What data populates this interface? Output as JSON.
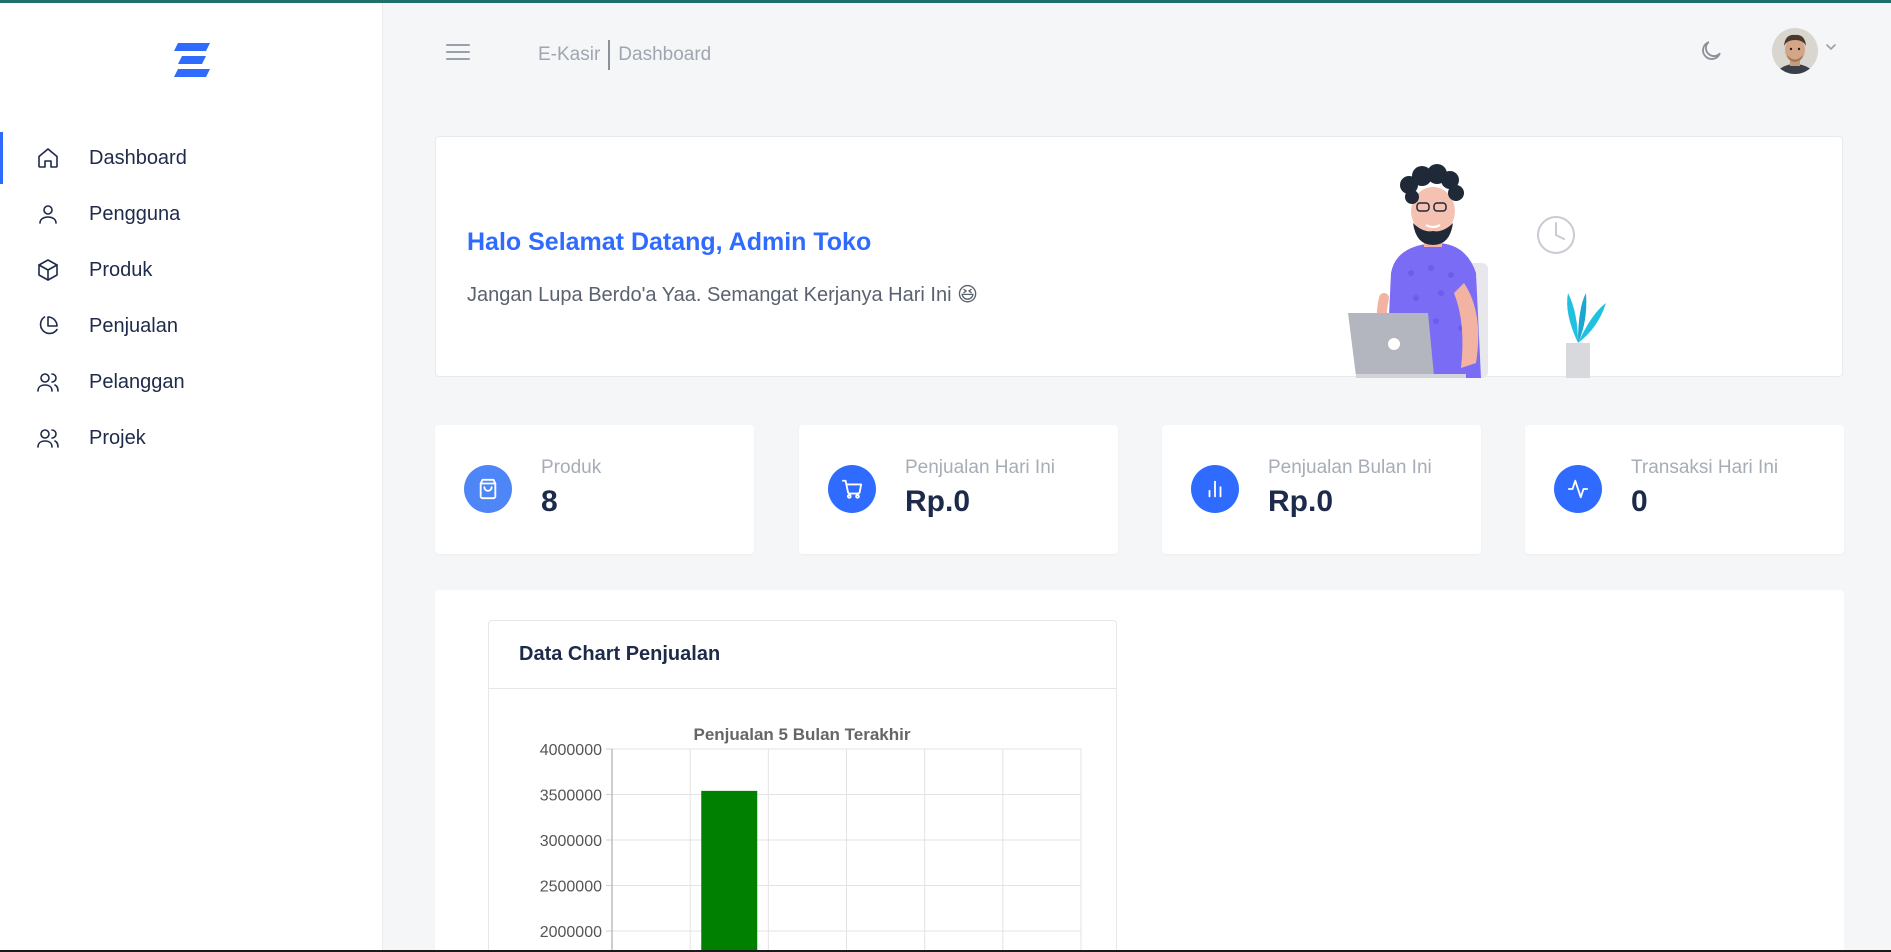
{
  "header": {
    "app_name": "E-Kasir",
    "page": "Dashboard"
  },
  "sidebar": {
    "items": [
      {
        "label": "Dashboard",
        "icon": "home-icon",
        "active": true
      },
      {
        "label": "Pengguna",
        "icon": "user-icon",
        "active": false
      },
      {
        "label": "Produk",
        "icon": "box-icon",
        "active": false
      },
      {
        "label": "Penjualan",
        "icon": "pie-chart-icon",
        "active": false
      },
      {
        "label": "Pelanggan",
        "icon": "users-icon",
        "active": false
      },
      {
        "label": "Projek",
        "icon": "users-icon",
        "active": false
      }
    ]
  },
  "welcome": {
    "title": "Halo Selamat Datang, Admin Toko",
    "subtitle": "Jangan Lupa Berdo'a Yaa. Semangat Kerjanya Hari Ini 😆"
  },
  "stats": [
    {
      "label": "Produk",
      "value": "8",
      "icon": "shopping-bag-icon"
    },
    {
      "label": "Penjualan Hari Ini",
      "value": "Rp.0",
      "icon": "cart-icon"
    },
    {
      "label": "Penjualan Bulan Ini",
      "value": "Rp.0",
      "icon": "bar-chart-icon"
    },
    {
      "label": "Transaksi Hari Ini",
      "value": "0",
      "icon": "activity-icon"
    }
  ],
  "chart_section": {
    "title": "Data Chart Penjualan"
  },
  "colors": {
    "accent": "#2f6bff",
    "bar": "#008000"
  },
  "chart_data": {
    "type": "bar",
    "title": "Penjualan 5 Bulan Terakhir",
    "categories": [
      "",
      "",
      "",
      "",
      "",
      ""
    ],
    "values": [
      null,
      3540000,
      null,
      null,
      null,
      null
    ],
    "yticks": [
      4000000,
      3500000,
      3000000,
      2500000,
      2000000
    ],
    "ylim": [
      2000000,
      4000000
    ],
    "grid": true
  }
}
